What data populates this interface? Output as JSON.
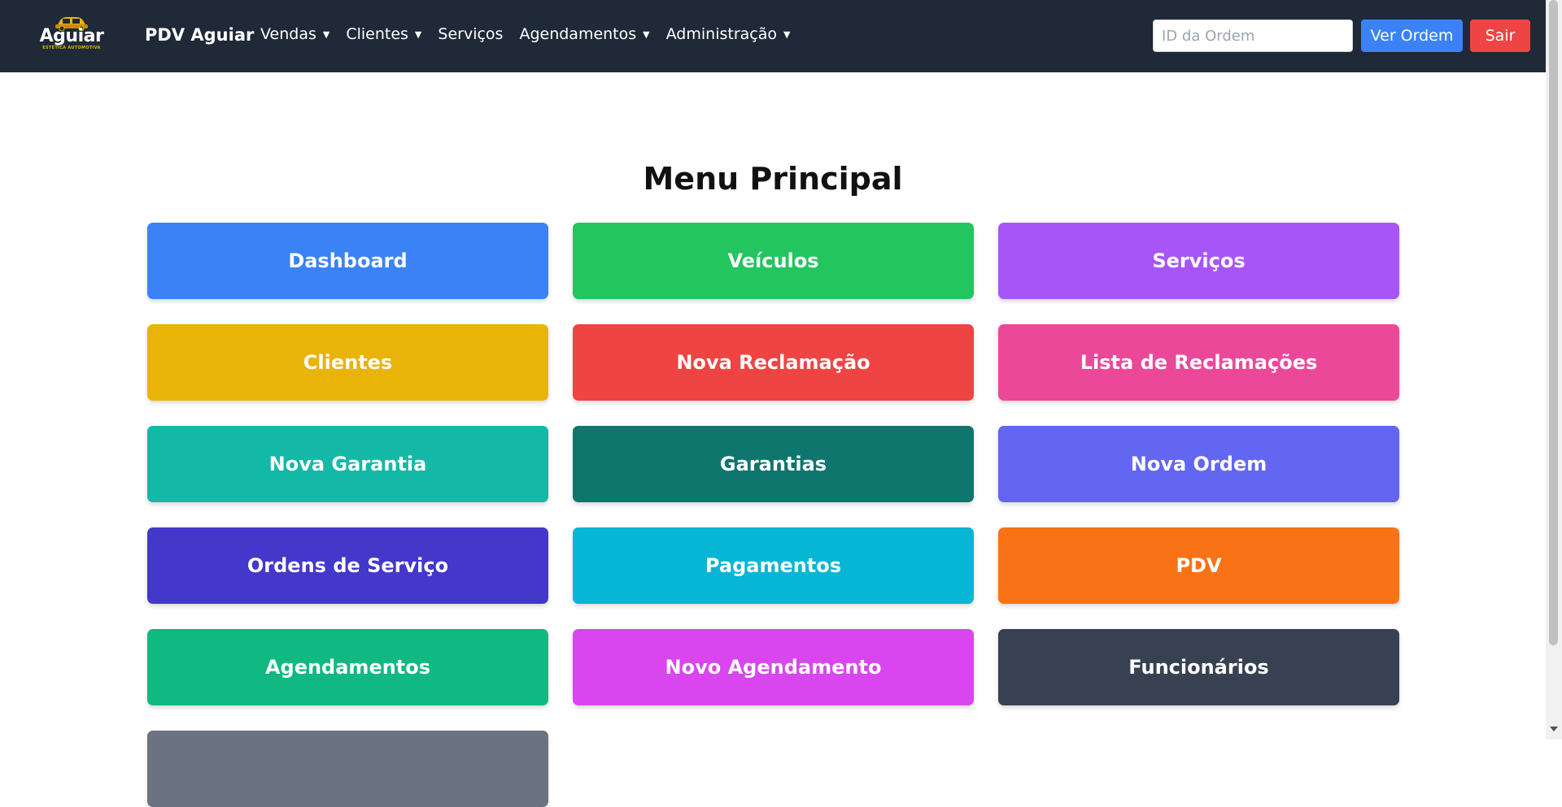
{
  "navbar": {
    "logo_text": "Aguiar",
    "logo_subtext": "ESTÉTICA AUTOMOTIVA",
    "brand": "PDV Aguiar",
    "menu": [
      {
        "label": "Vendas",
        "dropdown": true
      },
      {
        "label": "Clientes",
        "dropdown": true
      },
      {
        "label": "Serviços",
        "dropdown": false
      },
      {
        "label": "Agendamentos",
        "dropdown": true
      },
      {
        "label": "Administração",
        "dropdown": true
      }
    ],
    "order_input": {
      "placeholder": "ID da Ordem",
      "value": ""
    },
    "view_order_label": "Ver Ordem",
    "exit_label": "Sair"
  },
  "main": {
    "title": "Menu Principal",
    "tiles": [
      {
        "label": "Dashboard",
        "color": "#3b82f6"
      },
      {
        "label": "Veículos",
        "color": "#22c55e"
      },
      {
        "label": "Serviços",
        "color": "#a855f7"
      },
      {
        "label": "Clientes",
        "color": "#eab308"
      },
      {
        "label": "Nova Reclamação",
        "color": "#ef4444"
      },
      {
        "label": "Lista de Reclamações",
        "color": "#ec4899"
      },
      {
        "label": "Nova Garantia",
        "color": "#14b8a6"
      },
      {
        "label": "Garantias",
        "color": "#0f766e"
      },
      {
        "label": "Nova Ordem",
        "color": "#6366f1"
      },
      {
        "label": "Ordens de Serviço",
        "color": "#4338ca"
      },
      {
        "label": "Pagamentos",
        "color": "#06b6d4"
      },
      {
        "label": "PDV",
        "color": "#f97316"
      },
      {
        "label": "Agendamentos",
        "color": "#10b981"
      },
      {
        "label": "Novo Agendamento",
        "color": "#d946ef"
      },
      {
        "label": "Funcionários",
        "color": "#374151"
      },
      {
        "label": "",
        "color": "#6b7280"
      }
    ]
  }
}
